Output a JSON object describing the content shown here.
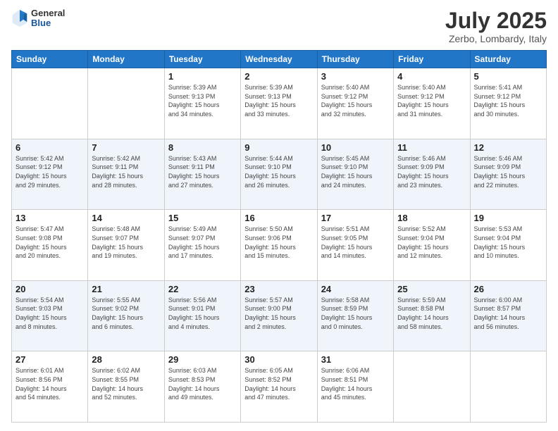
{
  "header": {
    "logo": {
      "line1": "General",
      "line2": "Blue"
    },
    "title": "July 2025",
    "location": "Zerbo, Lombardy, Italy"
  },
  "weekdays": [
    "Sunday",
    "Monday",
    "Tuesday",
    "Wednesday",
    "Thursday",
    "Friday",
    "Saturday"
  ],
  "weeks": [
    [
      {
        "day": "",
        "info": ""
      },
      {
        "day": "",
        "info": ""
      },
      {
        "day": "1",
        "info": "Sunrise: 5:39 AM\nSunset: 9:13 PM\nDaylight: 15 hours\nand 34 minutes."
      },
      {
        "day": "2",
        "info": "Sunrise: 5:39 AM\nSunset: 9:13 PM\nDaylight: 15 hours\nand 33 minutes."
      },
      {
        "day": "3",
        "info": "Sunrise: 5:40 AM\nSunset: 9:12 PM\nDaylight: 15 hours\nand 32 minutes."
      },
      {
        "day": "4",
        "info": "Sunrise: 5:40 AM\nSunset: 9:12 PM\nDaylight: 15 hours\nand 31 minutes."
      },
      {
        "day": "5",
        "info": "Sunrise: 5:41 AM\nSunset: 9:12 PM\nDaylight: 15 hours\nand 30 minutes."
      }
    ],
    [
      {
        "day": "6",
        "info": "Sunrise: 5:42 AM\nSunset: 9:12 PM\nDaylight: 15 hours\nand 29 minutes."
      },
      {
        "day": "7",
        "info": "Sunrise: 5:42 AM\nSunset: 9:11 PM\nDaylight: 15 hours\nand 28 minutes."
      },
      {
        "day": "8",
        "info": "Sunrise: 5:43 AM\nSunset: 9:11 PM\nDaylight: 15 hours\nand 27 minutes."
      },
      {
        "day": "9",
        "info": "Sunrise: 5:44 AM\nSunset: 9:10 PM\nDaylight: 15 hours\nand 26 minutes."
      },
      {
        "day": "10",
        "info": "Sunrise: 5:45 AM\nSunset: 9:10 PM\nDaylight: 15 hours\nand 24 minutes."
      },
      {
        "day": "11",
        "info": "Sunrise: 5:46 AM\nSunset: 9:09 PM\nDaylight: 15 hours\nand 23 minutes."
      },
      {
        "day": "12",
        "info": "Sunrise: 5:46 AM\nSunset: 9:09 PM\nDaylight: 15 hours\nand 22 minutes."
      }
    ],
    [
      {
        "day": "13",
        "info": "Sunrise: 5:47 AM\nSunset: 9:08 PM\nDaylight: 15 hours\nand 20 minutes."
      },
      {
        "day": "14",
        "info": "Sunrise: 5:48 AM\nSunset: 9:07 PM\nDaylight: 15 hours\nand 19 minutes."
      },
      {
        "day": "15",
        "info": "Sunrise: 5:49 AM\nSunset: 9:07 PM\nDaylight: 15 hours\nand 17 minutes."
      },
      {
        "day": "16",
        "info": "Sunrise: 5:50 AM\nSunset: 9:06 PM\nDaylight: 15 hours\nand 15 minutes."
      },
      {
        "day": "17",
        "info": "Sunrise: 5:51 AM\nSunset: 9:05 PM\nDaylight: 15 hours\nand 14 minutes."
      },
      {
        "day": "18",
        "info": "Sunrise: 5:52 AM\nSunset: 9:04 PM\nDaylight: 15 hours\nand 12 minutes."
      },
      {
        "day": "19",
        "info": "Sunrise: 5:53 AM\nSunset: 9:04 PM\nDaylight: 15 hours\nand 10 minutes."
      }
    ],
    [
      {
        "day": "20",
        "info": "Sunrise: 5:54 AM\nSunset: 9:03 PM\nDaylight: 15 hours\nand 8 minutes."
      },
      {
        "day": "21",
        "info": "Sunrise: 5:55 AM\nSunset: 9:02 PM\nDaylight: 15 hours\nand 6 minutes."
      },
      {
        "day": "22",
        "info": "Sunrise: 5:56 AM\nSunset: 9:01 PM\nDaylight: 15 hours\nand 4 minutes."
      },
      {
        "day": "23",
        "info": "Sunrise: 5:57 AM\nSunset: 9:00 PM\nDaylight: 15 hours\nand 2 minutes."
      },
      {
        "day": "24",
        "info": "Sunrise: 5:58 AM\nSunset: 8:59 PM\nDaylight: 15 hours\nand 0 minutes."
      },
      {
        "day": "25",
        "info": "Sunrise: 5:59 AM\nSunset: 8:58 PM\nDaylight: 14 hours\nand 58 minutes."
      },
      {
        "day": "26",
        "info": "Sunrise: 6:00 AM\nSunset: 8:57 PM\nDaylight: 14 hours\nand 56 minutes."
      }
    ],
    [
      {
        "day": "27",
        "info": "Sunrise: 6:01 AM\nSunset: 8:56 PM\nDaylight: 14 hours\nand 54 minutes."
      },
      {
        "day": "28",
        "info": "Sunrise: 6:02 AM\nSunset: 8:55 PM\nDaylight: 14 hours\nand 52 minutes."
      },
      {
        "day": "29",
        "info": "Sunrise: 6:03 AM\nSunset: 8:53 PM\nDaylight: 14 hours\nand 49 minutes."
      },
      {
        "day": "30",
        "info": "Sunrise: 6:05 AM\nSunset: 8:52 PM\nDaylight: 14 hours\nand 47 minutes."
      },
      {
        "day": "31",
        "info": "Sunrise: 6:06 AM\nSunset: 8:51 PM\nDaylight: 14 hours\nand 45 minutes."
      },
      {
        "day": "",
        "info": ""
      },
      {
        "day": "",
        "info": ""
      }
    ]
  ]
}
